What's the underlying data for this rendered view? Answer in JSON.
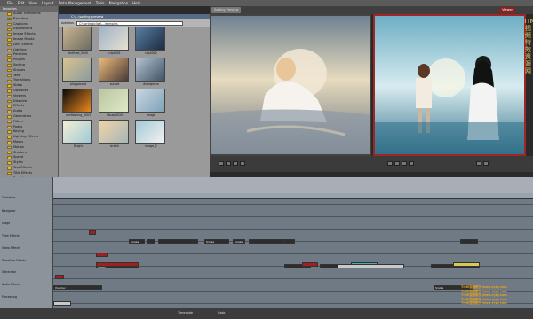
{
  "menu": [
    "File",
    "Edit",
    "View",
    "Layout",
    "Data Management",
    "Tools",
    "Navigation",
    "Help"
  ],
  "viewer_tabs": {
    "left": "Sorting  Preview",
    "a": "",
    "b": "",
    "right": "Viewer"
  },
  "tree": {
    "title": "Favorites",
    "items": [
      "Audio Transitions",
      "Backdrop",
      "Captions",
      "Expressions",
      "Image Effects",
      "Image Masks",
      "Lens Effects",
      "Lighting",
      "Particles",
      "Plugins",
      "Sorting",
      "Shapes",
      "Text",
      "Transitions",
      "Video",
      "Uploaded",
      "Viewers",
      "Dissolve",
      "Effects",
      "Audio",
      "Generators",
      "Filters",
      "Fades",
      "Keying",
      "Lighting Effects",
      "Masks",
      "Motion",
      "Shaders",
      "Speed",
      "Styles",
      "Text Effects",
      "Title Effects",
      "Transform",
      "Utility",
      "Video Effects",
      "Video Plugins",
      "Warp",
      "Wipes"
    ]
  },
  "browser": {
    "title": "C:\\...\\sorting preview",
    "address_label": "Address",
    "address": "C:\\sorting\\clips\\...\\samples",
    "thumbs": [
      {
        "label": "Untitled_0000",
        "c1": "#c8b590",
        "c2": "#6d6a62"
      },
      {
        "label": "clip0001",
        "c1": "#9fb4c6",
        "c2": "#e6e0d2"
      },
      {
        "label": "clip0002",
        "c1": "#5a7ea3",
        "c2": "#1c2b40"
      },
      {
        "label": "",
        "c1": "#9a9a9a",
        "c2": "#9a9a9a"
      },
      {
        "label": "playground",
        "c1": "#d7c38d",
        "c2": "#8c9aa0"
      },
      {
        "label": "sunset",
        "c1": "#e9b87a",
        "c2": "#4a3b36"
      },
      {
        "label": "divergence",
        "c1": "#b4c2cf",
        "c2": "#3e5468"
      },
      {
        "label": "",
        "c1": "#9a9a9a",
        "c2": "#9a9a9a"
      },
      {
        "label": "sunflashing_0003",
        "c1": "#0a0a0a",
        "c2": "#f08a20"
      },
      {
        "label": "Mouse0020",
        "c1": "#b8c8a0",
        "c2": "#e0e6c8"
      },
      {
        "label": "image",
        "c1": "#c9d6e2",
        "c2": "#7fa2b7"
      },
      {
        "label": "",
        "c1": "#9a9a9a",
        "c2": "#9a9a9a"
      },
      {
        "label": "Bright",
        "c1": "#f6efd2",
        "c2": "#9ec9d9"
      },
      {
        "label": "bright",
        "c1": "#f0d4a8",
        "c2": "#a8b6b8"
      },
      {
        "label": "image_2",
        "c1": "#a3c9d6",
        "c2": "#f1f1f1"
      },
      {
        "label": "",
        "c1": "#9a9a9a",
        "c2": "#9a9a9a"
      }
    ]
  },
  "track_labels": [
    "Container",
    "Navigator",
    "Stage",
    "Time Effects",
    "Video Effects",
    "Transition Effects",
    "Generator",
    "Audio Effects",
    "Processing"
  ],
  "timeline_clips": [
    {
      "name": "Single",
      "track": "video1"
    },
    {
      "name": "Single",
      "track": "video1"
    },
    {
      "name": "Single",
      "track": "video2"
    },
    {
      "name": "Mixed",
      "track": "gen"
    },
    {
      "name": "Overlay",
      "track": "audio"
    },
    {
      "name": "Single",
      "track": "audio"
    }
  ],
  "status": {
    "left": "Timecode",
    "center": "Goto"
  },
  "watermark": {
    "vertical": "TIME 视 频 特 效 资 源 网",
    "lines": [
      "TIME视频教学 www.zyzy.com",
      "TIME视频教学 www.zyzy.com",
      "TIME视频教学 www.zyzy.com",
      "TIME视频教学 www.zyzy.com",
      "TIME视频教学 www.zyzy.com"
    ]
  }
}
